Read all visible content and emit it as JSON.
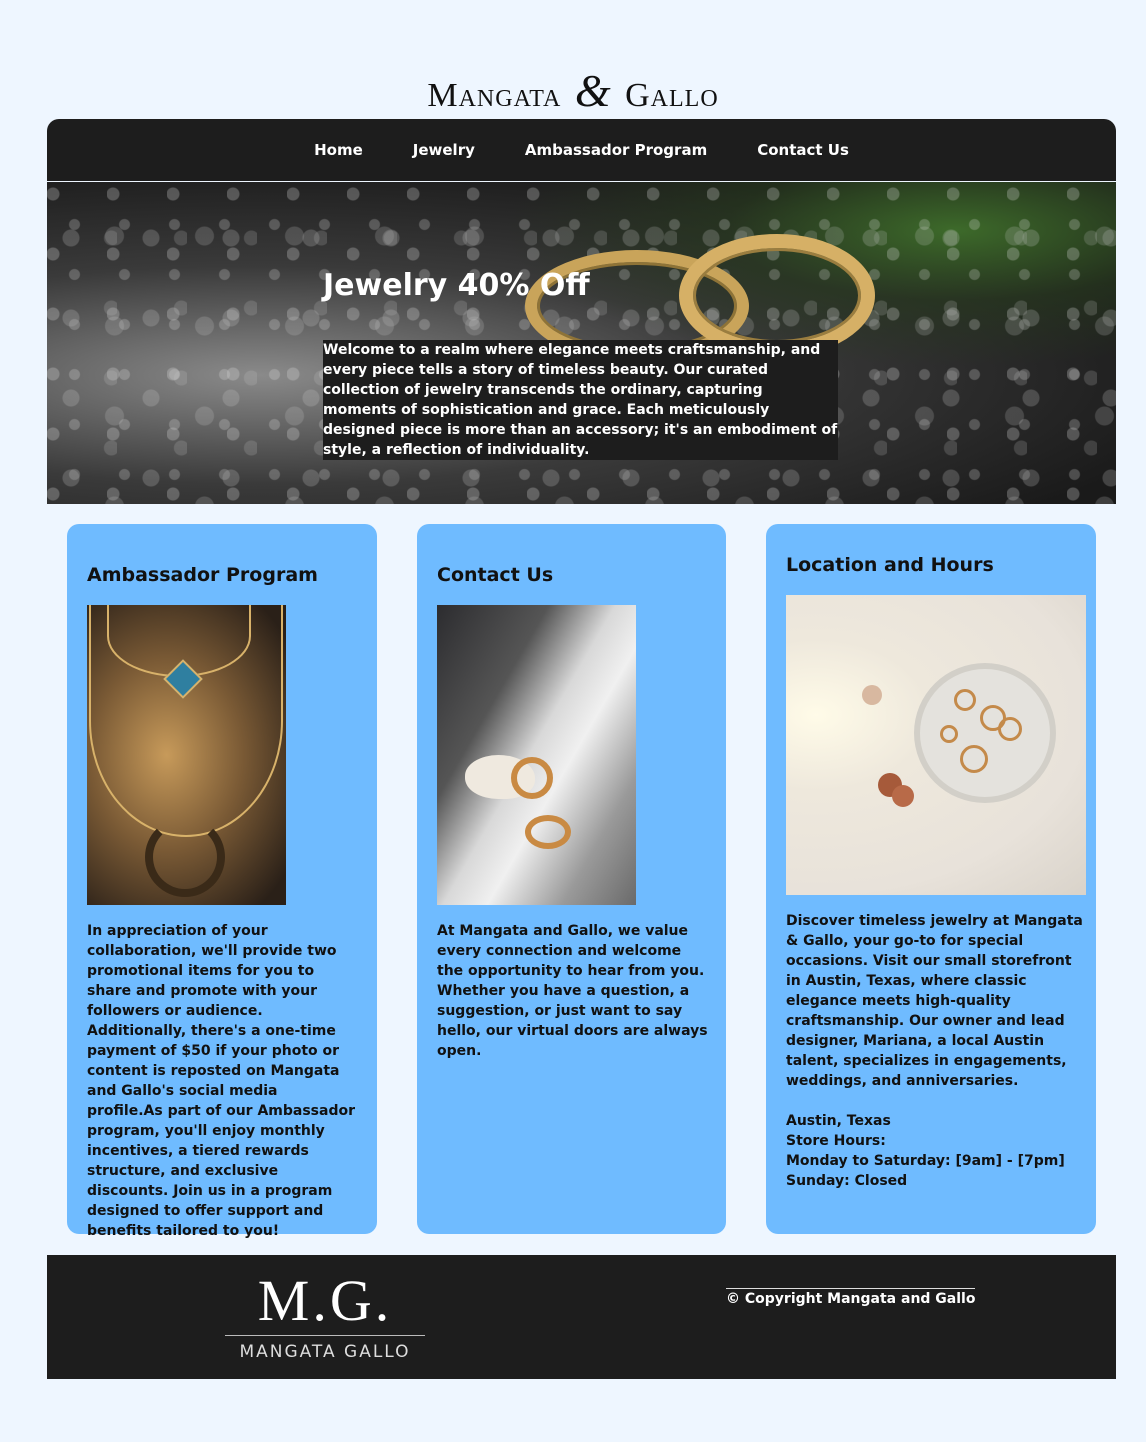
{
  "brand": {
    "left": "Mangata",
    "amp": "&",
    "right": "Gallo"
  },
  "nav": {
    "items": [
      "Home",
      "Jewelry",
      "Ambassador Program",
      "Contact Us"
    ]
  },
  "hero": {
    "heading": "Jewelry 40% Off",
    "blurb": "Welcome to a realm where elegance meets craftsmanship, and every piece tells a story of timeless beauty. Our curated collection of jewelry transcends the ordinary, capturing moments of sophistication and grace. Each meticulously designed piece is more than an accessory; it's an embodiment of style, a reflection of individuality."
  },
  "cards": [
    {
      "title": "Ambassador Program",
      "text": "In appreciation of your collaboration, we'll provide two promotional items for you to share and promote with your followers or audience. Additionally, there's a one-time payment of $50 if your photo or content is reposted on Mangata and Gallo's social media profile.As part of our Ambassador program, you'll enjoy monthly incentives, a tiered rewards structure, and exclusive discounts. Join us in a program designed to offer support and benefits tailored to you!"
    },
    {
      "title": "Contact Us",
      "text": "At Mangata and Gallo, we value every connection and welcome the opportunity to hear from you. Whether you have a question, a suggestion, or just want to say hello, our virtual doors are always open."
    },
    {
      "title": "Location and Hours",
      "text": "Discover timeless jewelry at Mangata & Gallo, your go-to for special occasions. Visit our small storefront in Austin, Texas, where classic elegance meets high-quality craftsmanship. Our owner and lead designer, Mariana, a local Austin talent, specializes in engagements, weddings, and anniversaries.\n\nAustin, Texas\nStore Hours:\nMonday to Saturday: [9am] - [7pm]\nSunday: Closed"
    }
  ],
  "footer": {
    "logo_big": "M.G.",
    "logo_small": "MANGATA GALLO",
    "copyright": "© Copyright Mangata and Gallo"
  },
  "colors": {
    "page_bg": "#eef6ff",
    "dark": "#1d1d1d",
    "card_bg": "#6fbbff"
  }
}
